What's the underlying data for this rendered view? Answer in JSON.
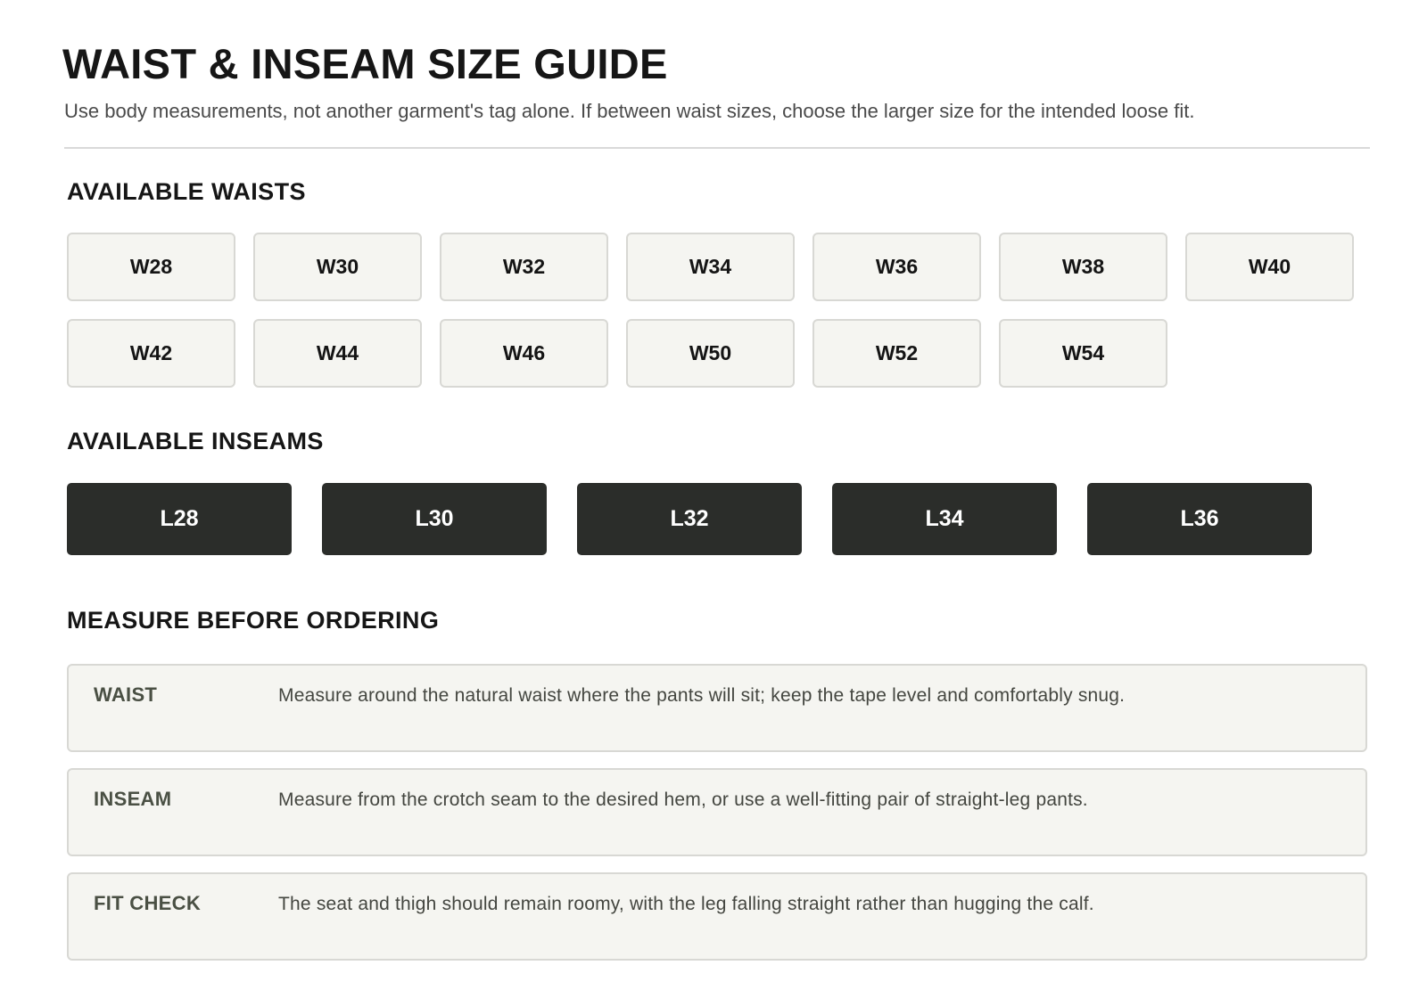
{
  "header": {
    "title": "WAIST & INSEAM SIZE GUIDE",
    "subtitle": "Use body measurements, not another garment's tag alone. If between waist sizes, choose the larger size for the intended loose fit."
  },
  "waists": {
    "heading": "AVAILABLE WAISTS",
    "options": [
      "W28",
      "W30",
      "W32",
      "W34",
      "W36",
      "W38",
      "W40",
      "W42",
      "W44",
      "W46",
      "W50",
      "W52",
      "W54"
    ]
  },
  "inseams": {
    "heading": "AVAILABLE INSEAMS",
    "options": [
      "L28",
      "L30",
      "L32",
      "L34",
      "L36"
    ]
  },
  "measure": {
    "heading": "MEASURE BEFORE ORDERING",
    "items": [
      {
        "label": "WAIST",
        "text": "Measure around the natural waist where the pants will sit; keep the tape level and comfortably snug."
      },
      {
        "label": "INSEAM",
        "text": "Measure from the crotch seam to the desired hem, or use a well-fitting pair of straight-leg pants."
      },
      {
        "label": "FIT CHECK",
        "text": "The seat and thigh should remain roomy, with the leg falling straight rather than hugging the calf."
      }
    ]
  },
  "colors": {
    "inseam_button_bg": "#2b2d2a",
    "waist_button_bg": "#f5f5f1",
    "measure_label": "#4a5044"
  }
}
